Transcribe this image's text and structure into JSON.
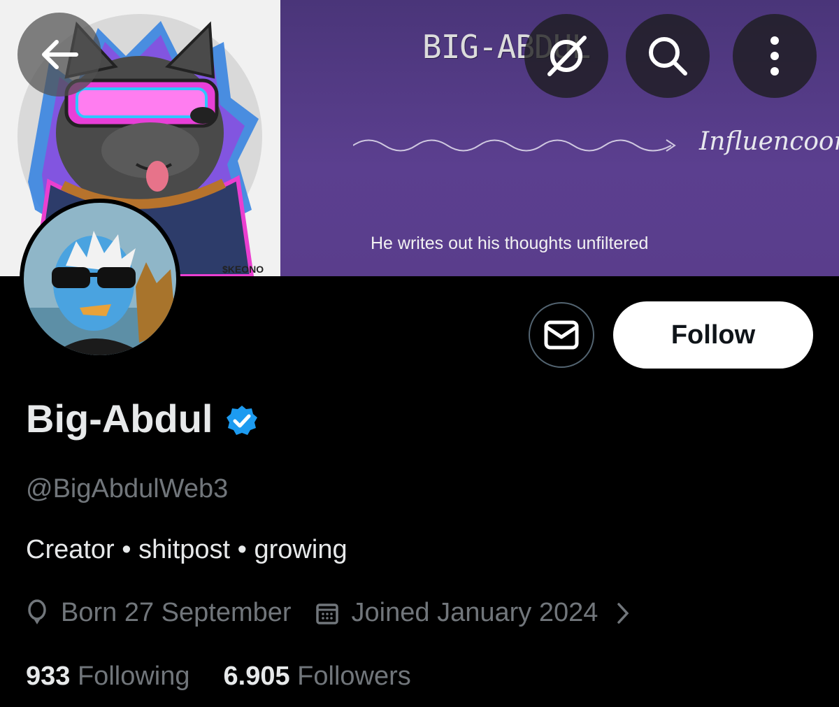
{
  "banner": {
    "title": "BIG-ABDUL",
    "subtitle": "Influencoor",
    "tagline": "He writes out his thoughts unfiltered",
    "artist_credit": "$KEONO"
  },
  "profile": {
    "display_name": "Big-Abdul",
    "handle": "@BigAbdulWeb3",
    "bio": "Creator • shitpost • growing",
    "birthday": "Born 27 September",
    "joined": "Joined January 2024",
    "following_count": "933",
    "following_label": "Following",
    "followers_count": "6.905",
    "followers_label": "Followers"
  },
  "actions": {
    "follow_label": "Follow"
  },
  "icons": {
    "back": "arrow-left-icon",
    "grok": "grok-icon",
    "search": "search-icon",
    "more": "more-vertical-icon",
    "message": "envelope-icon",
    "verified": "verified-badge-icon",
    "birthday": "balloon-icon",
    "calendar": "calendar-icon",
    "chevron": "chevron-right-icon"
  },
  "colors": {
    "background": "#000000",
    "primary_text": "#e7e9ea",
    "secondary_text": "#71767b",
    "verified_blue": "#1d9bf0",
    "banner_purple": "#553a87",
    "follow_button_bg": "#ffffff"
  }
}
